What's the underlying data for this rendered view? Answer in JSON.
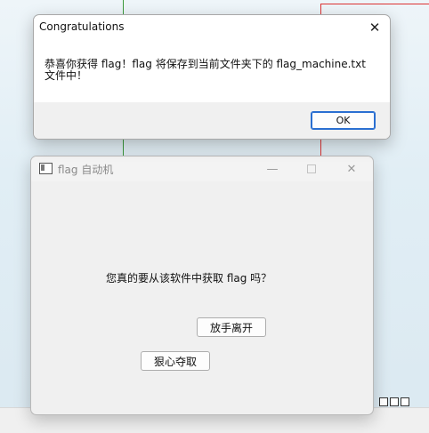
{
  "message_box": {
    "title": "Congratulations",
    "close_glyph": "✕",
    "message_line1": "恭喜你获得 flag！flag 将保存到当前文件夹下的 flag_machine.txt",
    "message_line2": "文件中！",
    "ok_label": "OK"
  },
  "app_window": {
    "title": "flag 自动机",
    "minimize_glyph": "—",
    "close_glyph": "✕",
    "question": "您真的要从该软件中获取 flag 吗？",
    "leave_label": "放手离开",
    "take_label": "狠心夺取"
  }
}
